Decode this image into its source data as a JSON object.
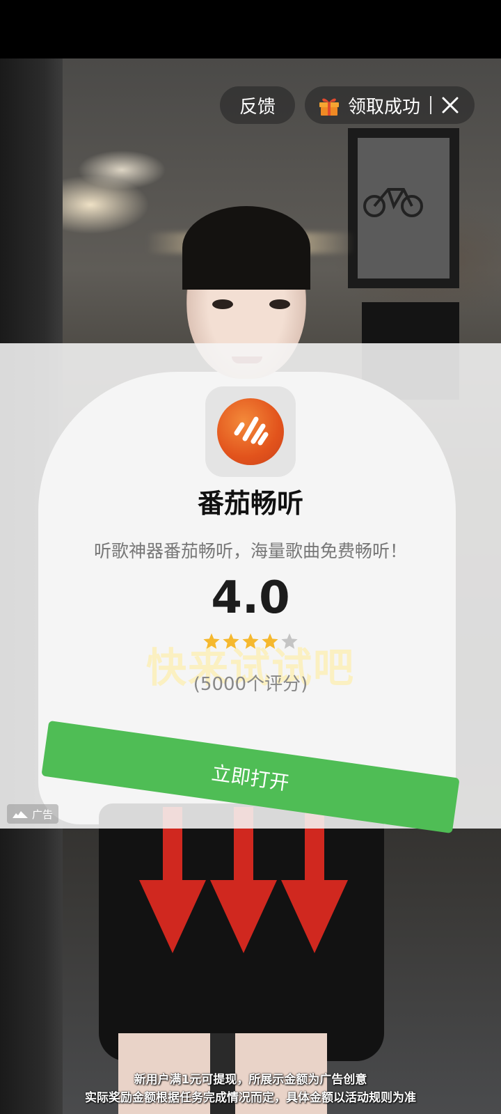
{
  "top_controls": {
    "feedback_label": "反馈",
    "reward_label": "领取成功",
    "gift_icon": "gift-icon",
    "close_icon": "close-icon"
  },
  "ad_card": {
    "app_name": "番茄畅听",
    "description": "听歌神器番茄畅听，海量歌曲免费畅听！",
    "rating": "4.0",
    "rating_stars": 4,
    "rating_max": 5,
    "rating_count": "(5000个评分)",
    "open_button_label": "立即打开",
    "ad_badge_label": "广告",
    "accent_color": "#4fbd55",
    "logo_color": "#e2531c"
  },
  "video": {
    "caption": "快来试试吧"
  },
  "disclaimer": {
    "line1": "新用户满1元可提现，所展示金额为广告创意",
    "line2": "实际奖励金额根据任务完成情况而定，具体金额以活动规则为准"
  }
}
